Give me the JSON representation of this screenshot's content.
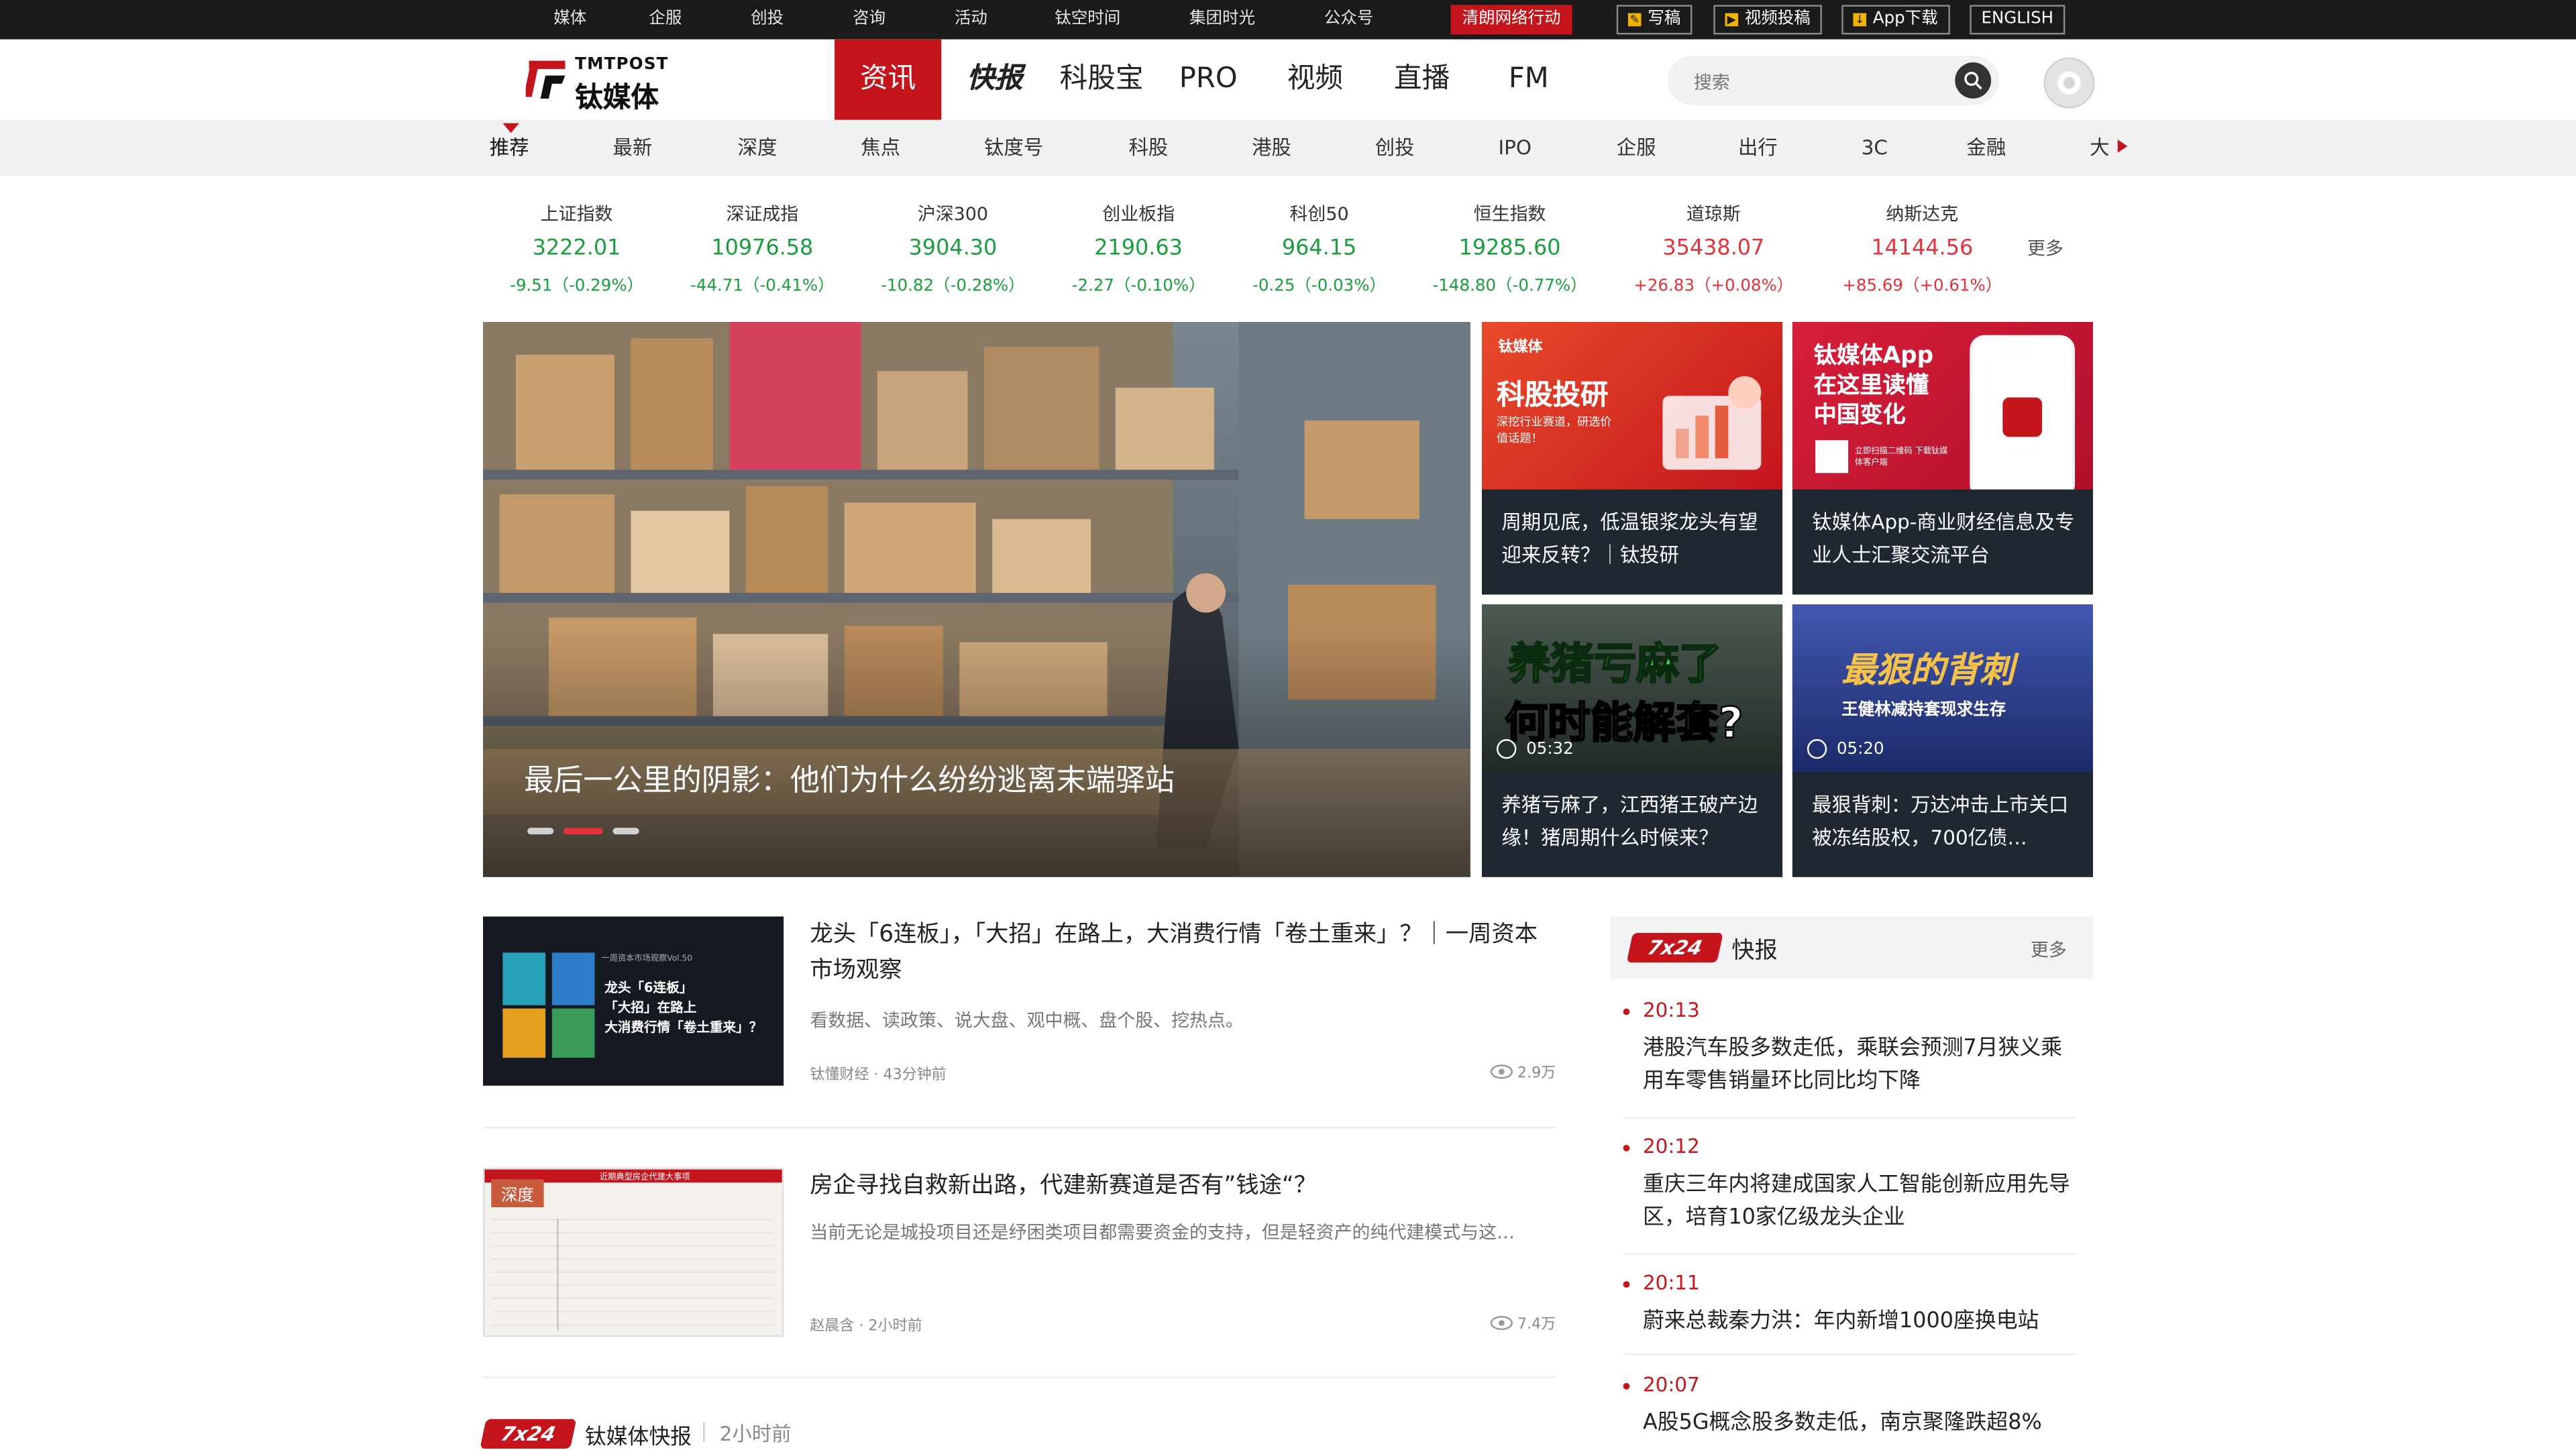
{
  "topbar": {
    "links": [
      "媒体",
      "企服",
      "创投",
      "咨询",
      "活动",
      "钛空时间",
      "集团时光",
      "公众号"
    ],
    "highlight": "清朗网络行动",
    "buttons": [
      {
        "label": "写稿",
        "icon": "pencil-icon"
      },
      {
        "label": "视频投稿",
        "icon": "video-icon"
      },
      {
        "label": "App下载",
        "icon": "download-icon"
      }
    ],
    "english": "ENGLISH"
  },
  "header": {
    "logo_en": "TMTPOST",
    "logo_cn": "钛媒体",
    "nav": [
      "资讯",
      "快报",
      "科股宝",
      "PRO",
      "视频",
      "直播",
      "FM"
    ],
    "search_placeholder": "搜索"
  },
  "subnav": [
    "推荐",
    "最新",
    "深度",
    "焦点",
    "钛度号",
    "科股",
    "港股",
    "创投",
    "IPO",
    "企服",
    "出行",
    "3C",
    "金融",
    "大"
  ],
  "stocks": [
    {
      "name": "上证指数",
      "value": "3222.01",
      "change": "-9.51（-0.29%）",
      "dir": "down"
    },
    {
      "name": "深证成指",
      "value": "10976.58",
      "change": "-44.71（-0.41%）",
      "dir": "down"
    },
    {
      "name": "沪深300",
      "value": "3904.30",
      "change": "-10.82（-0.28%）",
      "dir": "down"
    },
    {
      "name": "创业板指",
      "value": "2190.63",
      "change": "-2.27（-0.10%）",
      "dir": "down"
    },
    {
      "name": "科创50",
      "value": "964.15",
      "change": "-0.25（-0.03%）",
      "dir": "down"
    },
    {
      "name": "恒生指数",
      "value": "19285.60",
      "change": "-148.80（-0.77%）",
      "dir": "down"
    },
    {
      "name": "道琼斯",
      "value": "35438.07",
      "change": "+26.83（+0.08%）",
      "dir": "up"
    },
    {
      "name": "纳斯达克",
      "value": "14144.56",
      "change": "+85.69（+0.61%）",
      "dir": "up"
    }
  ],
  "stocks_more": "更多",
  "hero": {
    "title": "最后一公里的阴影：他们为什么纷纷逃离末端驿站"
  },
  "cards": [
    {
      "img_title": "科股投研",
      "img_sub": "深挖行业赛道，研选价值话题！",
      "img_brand": "钛媒体",
      "caption": "周期见底，低温银浆龙头有望迎来反转？｜钛投研"
    },
    {
      "img_title": "钛媒体App\n在这里读懂\n中国变化",
      "img_sub": "立即扫描二维码 下载钛媒体客户端",
      "caption": "钛媒体App-商业财经信息及专业人士汇聚交流平台"
    },
    {
      "img_title1": "养猪亏麻了",
      "img_title2": "何时能解套?",
      "duration": "05:32",
      "caption": "养猪亏麻了，江西猪王破产边缘！猪周期什么时候来？"
    },
    {
      "img_title1": "最狠的背刺",
      "img_title2": "王健林减持套现求生存",
      "duration": "05:20",
      "caption": "最狠背刺：万达冲击上市关口被冻结股权，700亿债…"
    }
  ],
  "articles": [
    {
      "title": "龙头「6连板」，「大招」在路上，大消费行情「卷土重来」？｜一周资本市场观察",
      "desc": "看数据、读政策、说大盘、观中概、盘个股、挖热点。",
      "meta": "钛懂财经 · 43分钟前",
      "views": "2.9万",
      "thumb_text": "龙头「6连板」\n「大招」在路上\n大消费行情「卷土重来」？",
      "thumb_tag": "一周资本市场观察Vol.50"
    },
    {
      "title": "房企寻找自救新出路，代建新赛道是否有”钱途“？",
      "desc": "当前无论是城投项目还是纾困类项目都需要资金的支持，但是轻资产的纯代建模式与这…",
      "meta": "赵晨含 · 2小时前",
      "views": "7.4万",
      "thumb_tag": "深度",
      "thumb_head": "近期典型房企代建大事项"
    }
  ],
  "bottom_flash": {
    "badge": "7x24",
    "label": "钛媒体快报",
    "time": "2小时前"
  },
  "flash": {
    "badge": "7x24",
    "label": "快报",
    "more": "更多",
    "items": [
      {
        "time": "20:13",
        "text": "港股汽车股多数走低，乘联会预测7月狭义乘用车零售销量环比同比均下降"
      },
      {
        "time": "20:12",
        "text": "重庆三年内将建成国家人工智能创新应用先导区，培育10家亿级龙头企业"
      },
      {
        "time": "20:11",
        "text": "蔚来总裁秦力洪：年内新增1000座换电站"
      },
      {
        "time": "20:07",
        "text": "A股5G概念股多数走低，南京聚隆跌超8%"
      }
    ]
  },
  "colors": {
    "brand_red": "#c4151c",
    "down_green": "#1a9e3d",
    "up_red": "#e0333b",
    "topbar": "#1a1a1a"
  }
}
